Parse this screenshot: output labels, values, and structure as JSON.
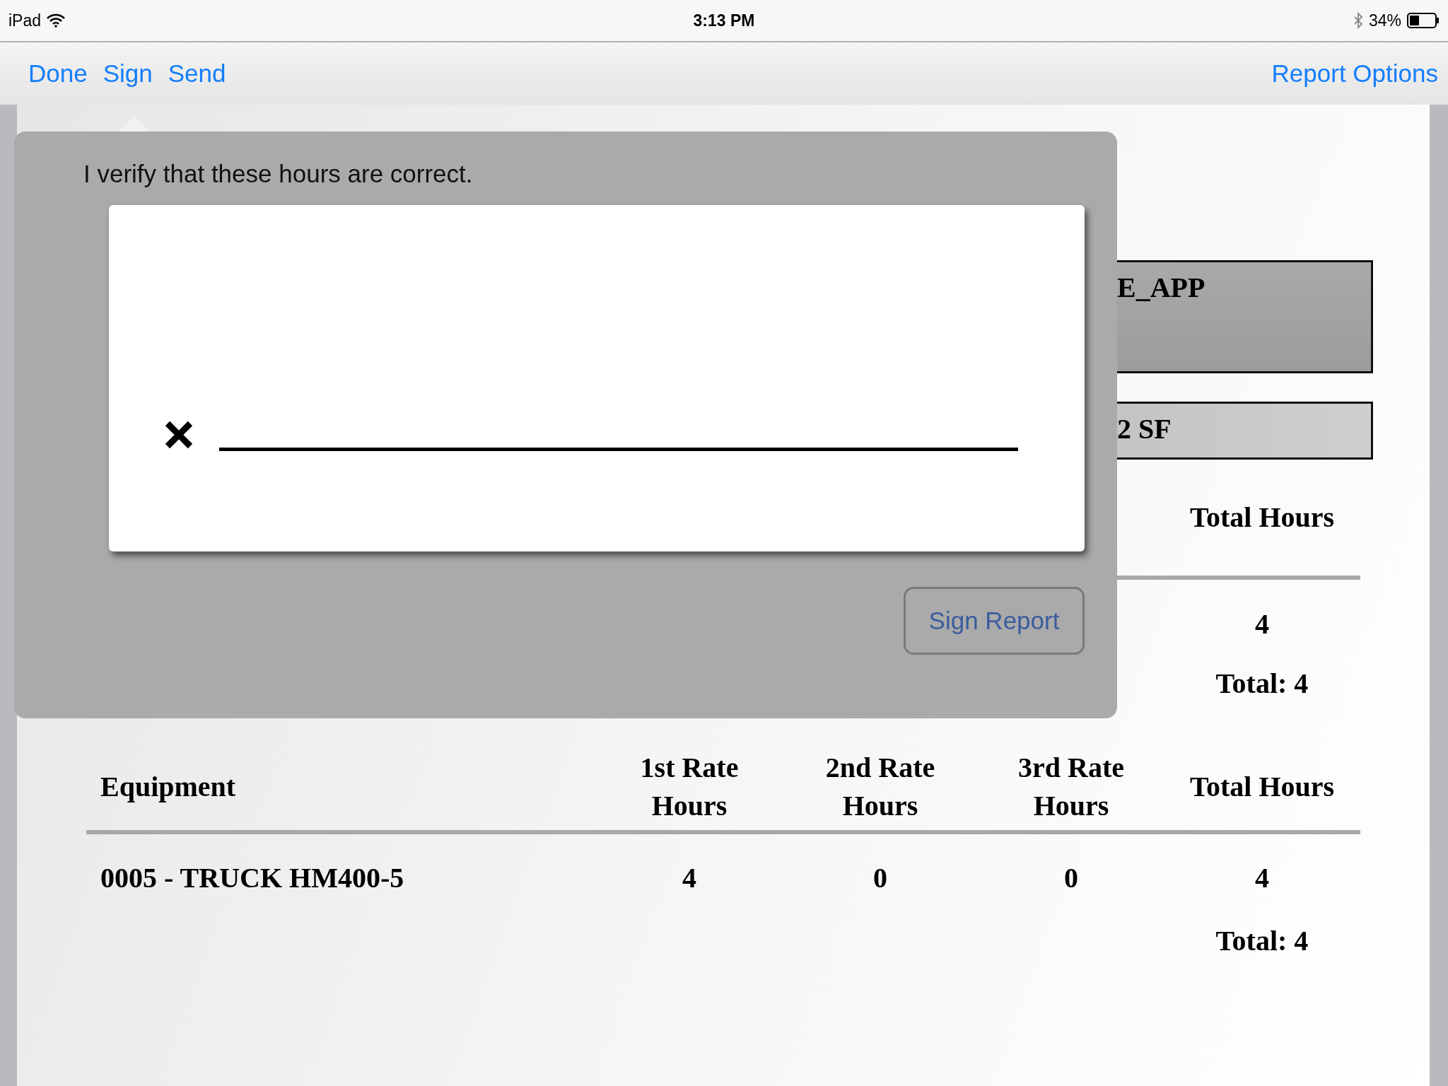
{
  "status_bar": {
    "device": "iPad",
    "time": "3:13 PM",
    "battery": "34%"
  },
  "nav_bar": {
    "left_buttons": [
      "Done",
      "Sign",
      "Send"
    ],
    "right_button": "Report Options"
  },
  "document": {
    "summary_boxes": [
      {
        "text": "E_APP",
        "kind": "dark"
      },
      {
        "text": "2 SF",
        "kind": "light"
      }
    ],
    "labor_table": {
      "columns": [
        "Total Hours"
      ],
      "rows": [
        [
          "4"
        ]
      ],
      "total": "Total: 4"
    },
    "equipment_table": {
      "columns": [
        "Equipment",
        "1st Rate\nHours",
        "2nd Rate\nHours",
        "3rd Rate\nHours",
        "Total Hours"
      ],
      "rows": [
        [
          "0005 - TRUCK HM400-5",
          "4",
          "0",
          "0",
          "4"
        ]
      ],
      "total": "Total: 4"
    }
  },
  "signature_popover": {
    "prompt": "I verify that these hours are correct.",
    "button": "Sign Report"
  }
}
